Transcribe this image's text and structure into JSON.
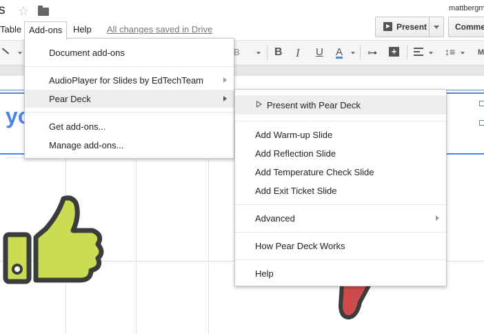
{
  "title_fragment": "s",
  "user": "mattbergm",
  "menubar": {
    "table": "Table",
    "addons": "Add-ons",
    "help": "Help",
    "saved_status": "All changes saved in Drive"
  },
  "buttons": {
    "present": "Present",
    "comments": "Comments"
  },
  "toolbar": {
    "bold": "B",
    "italic": "I",
    "underline": "U",
    "text_color": "A",
    "bold_partial": "B",
    "more_fragment": "M"
  },
  "slide": {
    "text_fragment": "yo"
  },
  "addons_menu": {
    "items": [
      {
        "label": "Document add-ons"
      },
      {
        "label": "AudioPlayer for Slides by EdTechTeam"
      },
      {
        "label": "Pear Deck"
      },
      {
        "label": "Get add-ons..."
      },
      {
        "label": "Manage add-ons..."
      }
    ]
  },
  "peardeck_menu": {
    "items": [
      {
        "label": "Present with Pear Deck"
      },
      {
        "label": "Add Warm-up Slide"
      },
      {
        "label": "Add Reflection Slide"
      },
      {
        "label": "Add Temperature Check Slide"
      },
      {
        "label": "Add Exit Ticket Slide"
      },
      {
        "label": "Advanced"
      },
      {
        "label": "How Pear Deck Works"
      },
      {
        "label": "Help"
      }
    ]
  },
  "colors": {
    "accent": "#4a86e8",
    "thumb_green": "#cbdc52",
    "thumb_outline": "#3b3d3d",
    "thumb_red": "#cf4b4b",
    "menu_highlight": "#eeeeee"
  },
  "icons": [
    "star-icon",
    "folder-icon",
    "play-icon",
    "line-icon",
    "link-icon",
    "insert-comment-icon",
    "align-icon",
    "line-spacing-icon",
    "thumbs-up-icon",
    "thumbs-down-icon"
  ]
}
